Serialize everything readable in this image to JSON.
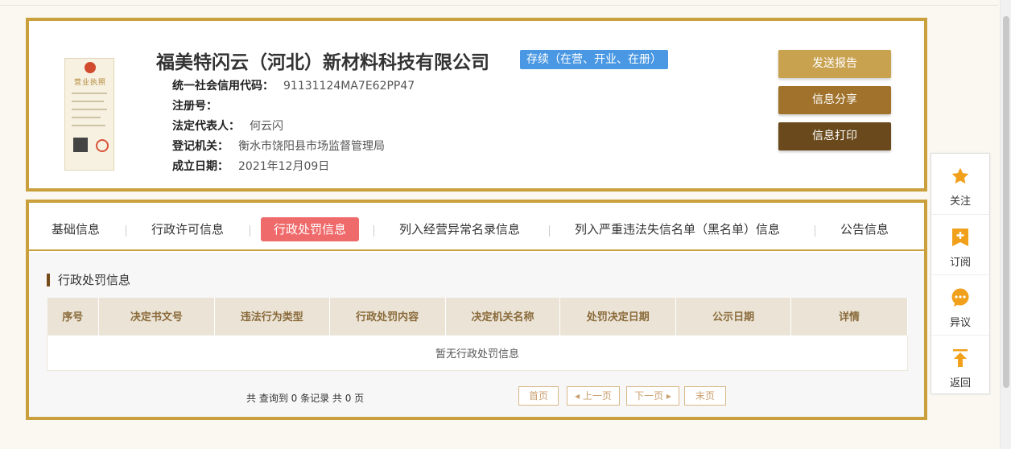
{
  "company": {
    "name": "福美特闪云（河北）新材料科技有限公司",
    "status": "存续（在营、开业、在册）",
    "license_title": "营业执照",
    "fields": [
      {
        "label": "统一社会信用代码：",
        "value": "91131124MA7E62PP47"
      },
      {
        "label": "注册号：",
        "value": ""
      },
      {
        "label": "法定代表人：",
        "value": "何云闪"
      },
      {
        "label": "登记机关：",
        "value": "衡水市饶阳县市场监督管理局"
      },
      {
        "label": "成立日期：",
        "value": "2021年12月09日"
      }
    ]
  },
  "actions": {
    "report": "发送报告",
    "share": "信息分享",
    "print": "信息打印"
  },
  "tabs": [
    {
      "label": "基础信息",
      "active": false
    },
    {
      "label": "行政许可信息",
      "active": false
    },
    {
      "label": "行政处罚信息",
      "active": true
    },
    {
      "label": "列入经营异常名录信息",
      "active": false
    },
    {
      "label": "列入严重违法失信名单（黑名单）信息",
      "active": false
    },
    {
      "label": "公告信息",
      "active": false
    }
  ],
  "section": {
    "title": "行政处罚信息",
    "columns": [
      "序号",
      "决定书文号",
      "违法行为类型",
      "行政处罚内容",
      "决定机关名称",
      "处罚决定日期",
      "公示日期",
      "详情"
    ],
    "empty_text": "暂无行政处罚信息"
  },
  "pagination": {
    "summary": "共 查询到 0 条记录 共 0 页",
    "first": "首页",
    "prev": "上一页",
    "next": "下一页",
    "last": "末页"
  },
  "sidebar": {
    "follow": "关注",
    "subscribe": "订阅",
    "objection": "异议",
    "back": "返回"
  },
  "colors": {
    "gold_border": "#c9a03b",
    "status_blue": "#4a98e3",
    "active_tab": "#ef6a6a",
    "icon_orange": "#f0a01a"
  },
  "icons": {
    "follow": "star-icon",
    "subscribe": "plus-bookmark-icon",
    "objection": "speech-bubble-icon",
    "back": "arrow-up-to-top-icon"
  }
}
